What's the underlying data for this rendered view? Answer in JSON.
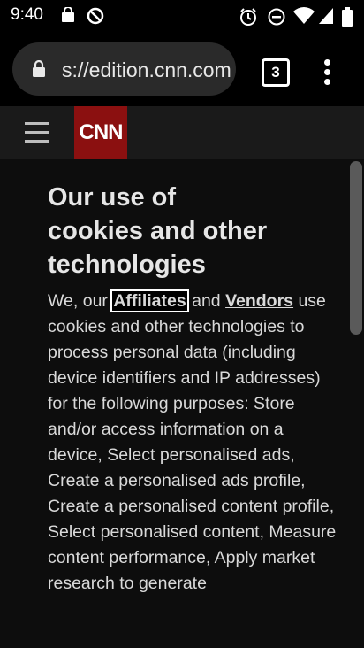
{
  "status_bar": {
    "time": "9:40",
    "left_icons": [
      "shopping-bag-icon",
      "no-disturb-circle-icon"
    ],
    "right_icons": [
      "alarm-icon",
      "do-not-disturb-icon",
      "wifi-icon",
      "signal-icon",
      "battery-icon"
    ]
  },
  "browser": {
    "url": "s://edition.cnn.com",
    "tab_count": "3",
    "menu_icon": "more-vert-icon"
  },
  "site": {
    "logo_text": "CNN"
  },
  "consent": {
    "title": "Our use of cookies and other technologies",
    "intro_we": "We, our ",
    "affiliates_link": "Affiliates",
    "and": " and ",
    "vendors_link": "Vendors",
    "body_rest": "use cookies and other technologies to process personal data (including device identifiers and IP addresses) for the following purposes: Store and/or access information on a device, Select personalised ads, Create a personalised ads profile, Create a personalised content profile, Select personalised content, Measure content performance, Apply market research to generate"
  }
}
